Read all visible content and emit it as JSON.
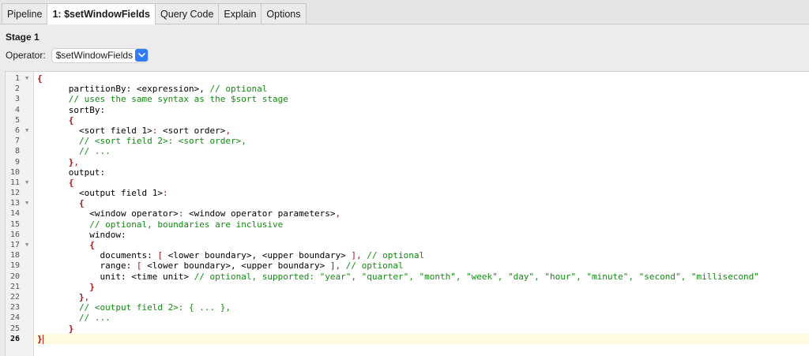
{
  "tabs": [
    {
      "label": "Pipeline",
      "active": false
    },
    {
      "label": "1: $setWindowFields",
      "active": true
    },
    {
      "label": "Query Code",
      "active": false
    },
    {
      "label": "Explain",
      "active": false
    },
    {
      "label": "Options",
      "active": false
    }
  ],
  "stage": {
    "title": "Stage 1",
    "operator_label": "Operator:",
    "operator_value": "$setWindowFields",
    "dropdown_icon": "chevron-down-icon"
  },
  "editor": {
    "current_line": 26,
    "fold_lines": [
      1,
      6,
      11,
      13,
      17
    ],
    "colors": {
      "brace": "#a31515",
      "comment": "#118a11",
      "text": "#000000",
      "current_line_bg": "#fffbe0"
    },
    "lines": [
      [
        [
          "b",
          "{"
        ]
      ],
      [
        [
          "t",
          "      partitionBy: <expression>, "
        ],
        [
          "c",
          "// optional"
        ]
      ],
      [
        [
          "c",
          "      // uses the same syntax as the $sort stage"
        ]
      ],
      [
        [
          "t",
          "      sortBy:"
        ]
      ],
      [
        [
          "t",
          "      "
        ],
        [
          "b",
          "{"
        ]
      ],
      [
        [
          "t",
          "        <sort field 1>"
        ],
        [
          "p",
          ":"
        ],
        [
          "t",
          " <sort order>"
        ],
        [
          "p",
          ","
        ]
      ],
      [
        [
          "c",
          "        // <sort field 2>: <sort order>,"
        ]
      ],
      [
        [
          "c",
          "        // ..."
        ]
      ],
      [
        [
          "t",
          "      "
        ],
        [
          "b",
          "}"
        ],
        [
          "p",
          ","
        ]
      ],
      [
        [
          "t",
          "      output:"
        ]
      ],
      [
        [
          "t",
          "      "
        ],
        [
          "b",
          "{"
        ]
      ],
      [
        [
          "t",
          "        <output field 1>"
        ],
        [
          "p",
          ":"
        ]
      ],
      [
        [
          "t",
          "        "
        ],
        [
          "b",
          "{"
        ]
      ],
      [
        [
          "t",
          "          <window operator>"
        ],
        [
          "p",
          ":"
        ],
        [
          "t",
          " <window operator parameters>"
        ],
        [
          "p",
          ","
        ]
      ],
      [
        [
          "c",
          "          // optional, boundaries are inclusive"
        ]
      ],
      [
        [
          "t",
          "          window:"
        ]
      ],
      [
        [
          "t",
          "          "
        ],
        [
          "b",
          "{"
        ]
      ],
      [
        [
          "t",
          "            documents: "
        ],
        [
          "p",
          "["
        ],
        [
          "t",
          " <lower boundary>, <upper boundary> "
        ],
        [
          "p",
          "]"
        ],
        [
          "p",
          ","
        ],
        [
          "c",
          " // optional"
        ]
      ],
      [
        [
          "t",
          "            range: "
        ],
        [
          "p",
          "["
        ],
        [
          "t",
          " <lower boundary>, <upper boundary> "
        ],
        [
          "p",
          "]"
        ],
        [
          "p",
          ","
        ],
        [
          "c",
          " // optional"
        ]
      ],
      [
        [
          "t",
          "            unit: <time unit> "
        ],
        [
          "c",
          "// optional, supported: \"year\", \"quarter\", \"month\", \"week\", \"day\", \"hour\", \"minute\", \"second\", \"millisecond\""
        ]
      ],
      [
        [
          "t",
          "          "
        ],
        [
          "b",
          "}"
        ]
      ],
      [
        [
          "t",
          "        "
        ],
        [
          "b",
          "}"
        ],
        [
          "p",
          ","
        ]
      ],
      [
        [
          "c",
          "        // <output field 2>: { ... },"
        ]
      ],
      [
        [
          "c",
          "        // ..."
        ]
      ],
      [
        [
          "t",
          "      "
        ],
        [
          "b",
          "}"
        ]
      ],
      [
        [
          "b",
          "}"
        ]
      ]
    ]
  }
}
